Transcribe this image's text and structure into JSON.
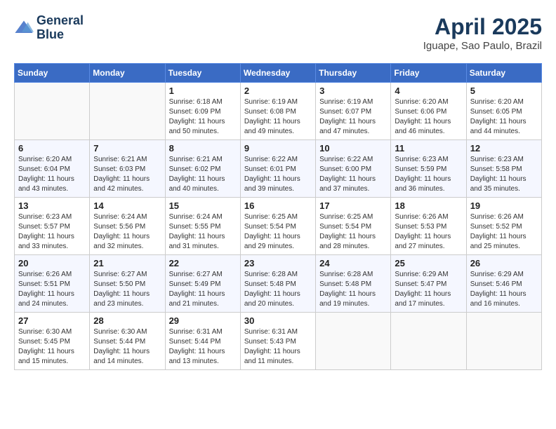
{
  "header": {
    "logo_line1": "General",
    "logo_line2": "Blue",
    "month_title": "April 2025",
    "location": "Iguape, Sao Paulo, Brazil"
  },
  "weekdays": [
    "Sunday",
    "Monday",
    "Tuesday",
    "Wednesday",
    "Thursday",
    "Friday",
    "Saturday"
  ],
  "weeks": [
    [
      {
        "day": "",
        "info": ""
      },
      {
        "day": "",
        "info": ""
      },
      {
        "day": "1",
        "info": "Sunrise: 6:18 AM\nSunset: 6:09 PM\nDaylight: 11 hours and 50 minutes."
      },
      {
        "day": "2",
        "info": "Sunrise: 6:19 AM\nSunset: 6:08 PM\nDaylight: 11 hours and 49 minutes."
      },
      {
        "day": "3",
        "info": "Sunrise: 6:19 AM\nSunset: 6:07 PM\nDaylight: 11 hours and 47 minutes."
      },
      {
        "day": "4",
        "info": "Sunrise: 6:20 AM\nSunset: 6:06 PM\nDaylight: 11 hours and 46 minutes."
      },
      {
        "day": "5",
        "info": "Sunrise: 6:20 AM\nSunset: 6:05 PM\nDaylight: 11 hours and 44 minutes."
      }
    ],
    [
      {
        "day": "6",
        "info": "Sunrise: 6:20 AM\nSunset: 6:04 PM\nDaylight: 11 hours and 43 minutes."
      },
      {
        "day": "7",
        "info": "Sunrise: 6:21 AM\nSunset: 6:03 PM\nDaylight: 11 hours and 42 minutes."
      },
      {
        "day": "8",
        "info": "Sunrise: 6:21 AM\nSunset: 6:02 PM\nDaylight: 11 hours and 40 minutes."
      },
      {
        "day": "9",
        "info": "Sunrise: 6:22 AM\nSunset: 6:01 PM\nDaylight: 11 hours and 39 minutes."
      },
      {
        "day": "10",
        "info": "Sunrise: 6:22 AM\nSunset: 6:00 PM\nDaylight: 11 hours and 37 minutes."
      },
      {
        "day": "11",
        "info": "Sunrise: 6:23 AM\nSunset: 5:59 PM\nDaylight: 11 hours and 36 minutes."
      },
      {
        "day": "12",
        "info": "Sunrise: 6:23 AM\nSunset: 5:58 PM\nDaylight: 11 hours and 35 minutes."
      }
    ],
    [
      {
        "day": "13",
        "info": "Sunrise: 6:23 AM\nSunset: 5:57 PM\nDaylight: 11 hours and 33 minutes."
      },
      {
        "day": "14",
        "info": "Sunrise: 6:24 AM\nSunset: 5:56 PM\nDaylight: 11 hours and 32 minutes."
      },
      {
        "day": "15",
        "info": "Sunrise: 6:24 AM\nSunset: 5:55 PM\nDaylight: 11 hours and 31 minutes."
      },
      {
        "day": "16",
        "info": "Sunrise: 6:25 AM\nSunset: 5:54 PM\nDaylight: 11 hours and 29 minutes."
      },
      {
        "day": "17",
        "info": "Sunrise: 6:25 AM\nSunset: 5:54 PM\nDaylight: 11 hours and 28 minutes."
      },
      {
        "day": "18",
        "info": "Sunrise: 6:26 AM\nSunset: 5:53 PM\nDaylight: 11 hours and 27 minutes."
      },
      {
        "day": "19",
        "info": "Sunrise: 6:26 AM\nSunset: 5:52 PM\nDaylight: 11 hours and 25 minutes."
      }
    ],
    [
      {
        "day": "20",
        "info": "Sunrise: 6:26 AM\nSunset: 5:51 PM\nDaylight: 11 hours and 24 minutes."
      },
      {
        "day": "21",
        "info": "Sunrise: 6:27 AM\nSunset: 5:50 PM\nDaylight: 11 hours and 23 minutes."
      },
      {
        "day": "22",
        "info": "Sunrise: 6:27 AM\nSunset: 5:49 PM\nDaylight: 11 hours and 21 minutes."
      },
      {
        "day": "23",
        "info": "Sunrise: 6:28 AM\nSunset: 5:48 PM\nDaylight: 11 hours and 20 minutes."
      },
      {
        "day": "24",
        "info": "Sunrise: 6:28 AM\nSunset: 5:48 PM\nDaylight: 11 hours and 19 minutes."
      },
      {
        "day": "25",
        "info": "Sunrise: 6:29 AM\nSunset: 5:47 PM\nDaylight: 11 hours and 17 minutes."
      },
      {
        "day": "26",
        "info": "Sunrise: 6:29 AM\nSunset: 5:46 PM\nDaylight: 11 hours and 16 minutes."
      }
    ],
    [
      {
        "day": "27",
        "info": "Sunrise: 6:30 AM\nSunset: 5:45 PM\nDaylight: 11 hours and 15 minutes."
      },
      {
        "day": "28",
        "info": "Sunrise: 6:30 AM\nSunset: 5:44 PM\nDaylight: 11 hours and 14 minutes."
      },
      {
        "day": "29",
        "info": "Sunrise: 6:31 AM\nSunset: 5:44 PM\nDaylight: 11 hours and 13 minutes."
      },
      {
        "day": "30",
        "info": "Sunrise: 6:31 AM\nSunset: 5:43 PM\nDaylight: 11 hours and 11 minutes."
      },
      {
        "day": "",
        "info": ""
      },
      {
        "day": "",
        "info": ""
      },
      {
        "day": "",
        "info": ""
      }
    ]
  ]
}
